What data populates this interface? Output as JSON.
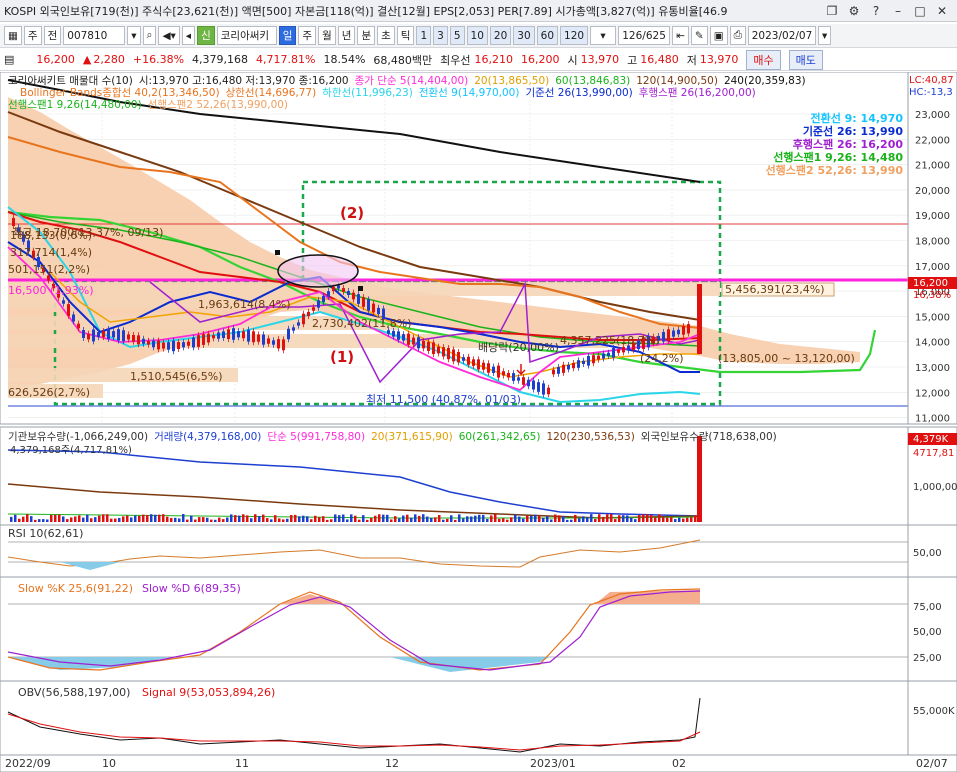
{
  "titlebar": {
    "text": "KOSPI 외국인보유[719(천)] 주식수[23,621(천)] 액면[500] 자본금[118(억)] 결산[12월] EPS[2,053] PER[7.89] 시가총액[3,827(억)] 유통비율[46.9"
  },
  "toolbar": {
    "market": "주",
    "type": "전",
    "code": "007810",
    "stock_name": "코리아써키",
    "periods": [
      "일",
      "주",
      "월",
      "년",
      "분",
      "초",
      "틱"
    ],
    "selected_period": "일",
    "intervals": [
      "1",
      "3",
      "5",
      "10",
      "20",
      "30",
      "60",
      "120"
    ],
    "count": "126/625",
    "date": "2023/02/07"
  },
  "quote": {
    "price": "16,200",
    "change": "2,280",
    "change_pct": "+16.38%",
    "volume": "4,379,168",
    "volume_ratio": "4,717.81%",
    "turnover": "18.54%",
    "amount": "68,480백만",
    "priority_label": "최우선",
    "ask": "16,210",
    "bid": "16,200",
    "open_label": "시",
    "open": "13,970",
    "high_label": "고",
    "high": "16,480",
    "low_label": "저",
    "low": "13,970",
    "buy": "매수",
    "sell": "매도"
  },
  "colors": {
    "up": "#e01010",
    "down": "#1d3fd0",
    "cloud": "#f6c9a5",
    "ma5": "#ff2bd9",
    "ma20": "#f2a300",
    "ma60": "#1bb21b",
    "ma120": "#7a3a10",
    "ma240": "#111111",
    "bb_upper": "#e8741e",
    "bb_lower": "#29d5e8",
    "conv": "#0a2bd0",
    "base": "#14c4ff",
    "leadA": "#35d435"
  },
  "main": {
    "legend1": [
      {
        "text": "코리아써키트 매물대 수(10)",
        "color": "#222"
      },
      {
        "text": "시:13,970 고:16,480 저:13,970 종:16,200",
        "color": "#222"
      },
      {
        "text": "종가 단순 5(14,404,00)",
        "color": "#ff2bd9"
      },
      {
        "text": "20(13,865,50)",
        "color": "#e0a000"
      },
      {
        "text": "60(13,846,83)",
        "color": "#1bb21b"
      },
      {
        "text": "120(14,900,50)",
        "color": "#7a3a10"
      },
      {
        "text": "240(20,359,83)",
        "color": "#111"
      }
    ],
    "legend2": [
      {
        "text": "Bollinger Bands종합선 40,2(13,346,50)",
        "color": "#e8741e"
      },
      {
        "text": "상한선(14,696,77)",
        "color": "#e8741e"
      },
      {
        "text": "하한선(11,996,23)",
        "color": "#29d5e8"
      },
      {
        "text": "전환선 9(14,970,00)",
        "color": "#14c4ff"
      },
      {
        "text": "기준선 26(13,990,00)",
        "color": "#0a2bd0"
      },
      {
        "text": "후행스팬 26(16,200,00)",
        "color": "#a020d0"
      }
    ],
    "legend3": [
      {
        "text": "선행스팬1 9,26(14,480,00)",
        "color": "#1bb21b"
      },
      {
        "text": "선행스팬2 52,26(13,990,00)",
        "color": "#f0a060"
      }
    ],
    "right_legend": [
      {
        "text": "전환선  9: 14,970",
        "color": "#14c4ff"
      },
      {
        "text": "기준선  26: 13,990",
        "color": "#0a2bd0"
      },
      {
        "text": "후행스팬  26: 16,200",
        "color": "#a020d0"
      },
      {
        "text": "선행스팬1  9,26: 14,480",
        "color": "#1bb21b"
      },
      {
        "text": "선행스팬2  52,26: 13,990",
        "color": "#f0a060"
      }
    ],
    "lc_label": "LC:40,87",
    "hc_label": "HC:-13,3",
    "y_ticks": [
      "23,000",
      "22,000",
      "21,000",
      "20,000",
      "19,000",
      "18,000",
      "17,000",
      "16,000",
      "15,000",
      "14,000",
      "13,000",
      "12,000",
      "11,000"
    ],
    "current_price_tag": "16,200",
    "current_pct_tag": "16,38%",
    "annotations": {
      "label1": "(1)",
      "label2": "(2)",
      "high_note": "최고 18,700(13,37%, 09/13)",
      "low_note": "최저 11,500 (40,87%, 01/03)",
      "line16500": "16,500 (1,93%)",
      "vp_rows": [
        "188,133(0,6%)",
        "317,714(1,4%)",
        "501,151(2,2%)",
        "1,963,614(8,4%)",
        "2,730,402(11,8%)",
        "1,510,545(6,5%)",
        "626,526(2,7%)",
        "4,357,225(18,7%)",
        "5,456,391(23,4%)"
      ],
      "cloud_note": "(13,805,00 ~ 13,120,00)",
      "cloud_pct": "(24,2%)",
      "buy_signal": "배당락(20,00%)"
    }
  },
  "volume_panel": {
    "legend": [
      {
        "text": "기관보유수량(-1,066,249,00)",
        "color": "#333"
      },
      {
        "text": "거래량(4,379,168,00)",
        "color": "#1d3fd0"
      },
      {
        "text": "단순 5(991,758,80)",
        "color": "#ff2bd9"
      },
      {
        "text": "20(371,615,90)",
        "color": "#e0a000"
      },
      {
        "text": "60(261,342,65)",
        "color": "#1bb21b"
      },
      {
        "text": "120(230,536,53)",
        "color": "#7a3a10"
      },
      {
        "text": "외국인보유수량(718,638,00)",
        "color": "#333"
      }
    ],
    "sub_note": "4,379,168주(4,717,81%)",
    "tag": "4,379K",
    "tag2": "4717,81",
    "y_tick": "1,000,00"
  },
  "rsi_panel": {
    "legend": "RSI 10(62,61)",
    "y_tick": "50,00"
  },
  "stoch_panel": {
    "legend_k": "Slow %K 25,6(91,22)",
    "legend_d": "Slow %D 6(89,35)",
    "y_ticks": [
      "75,00",
      "50,00",
      "25,00"
    ]
  },
  "obv_panel": {
    "legend_obv": "OBV(56,588,197,00)",
    "legend_sig": "Signal 9(53,053,894,26)",
    "y_tick": "55,000K"
  },
  "x_axis": [
    "2022/09",
    "10",
    "11",
    "12",
    "2023/01",
    "02",
    "02/07"
  ]
}
